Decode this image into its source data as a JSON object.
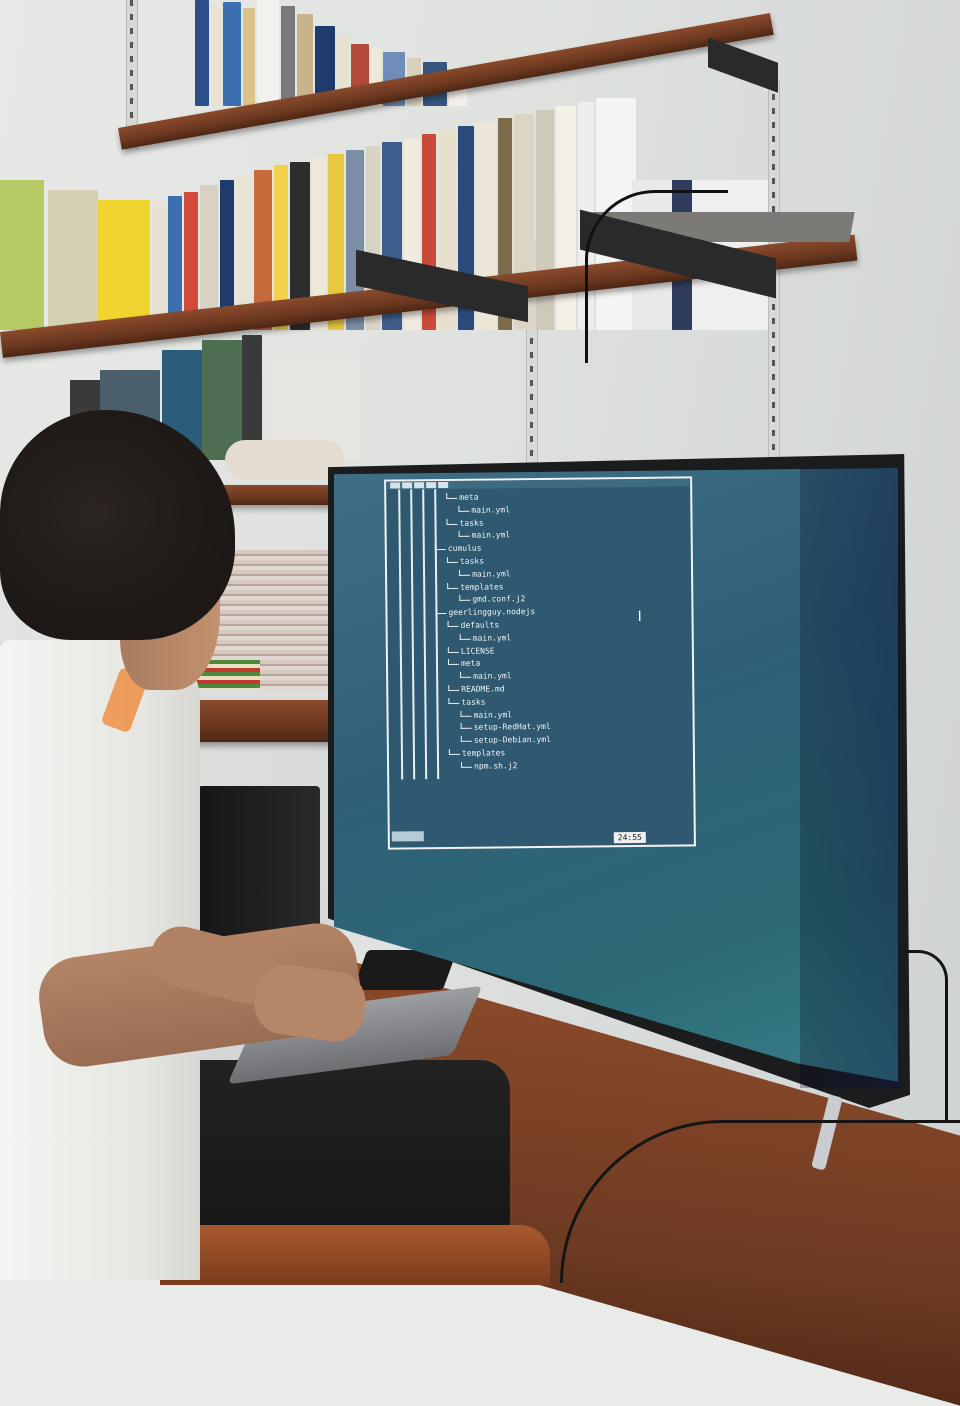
{
  "terminal": {
    "tree": [
      {
        "depth": 4,
        "text": "meta"
      },
      {
        "depth": 5,
        "text": "main.yml"
      },
      {
        "depth": 4,
        "text": "tasks"
      },
      {
        "depth": 5,
        "text": "main.yml"
      },
      {
        "depth": 3,
        "text": "cumulus"
      },
      {
        "depth": 4,
        "text": "tasks"
      },
      {
        "depth": 5,
        "text": "main.yml"
      },
      {
        "depth": 4,
        "text": "templates"
      },
      {
        "depth": 5,
        "text": "gmd.conf.j2"
      },
      {
        "depth": 3,
        "text": "geerlingguy.nodejs"
      },
      {
        "depth": 4,
        "text": "defaults"
      },
      {
        "depth": 5,
        "text": "main.yml"
      },
      {
        "depth": 4,
        "text": "LICENSE"
      },
      {
        "depth": 4,
        "text": "meta"
      },
      {
        "depth": 5,
        "text": "main.yml"
      },
      {
        "depth": 4,
        "text": "README.md"
      },
      {
        "depth": 4,
        "text": "tasks"
      },
      {
        "depth": 5,
        "text": "main.yml"
      },
      {
        "depth": 5,
        "text": "setup-RedHat.yml"
      },
      {
        "depth": 5,
        "text": "setup-Debian.yml"
      },
      {
        "depth": 4,
        "text": "templates"
      },
      {
        "depth": 5,
        "text": "npm.sh.j2"
      }
    ],
    "clock": "24:55"
  },
  "colors": {
    "screen": "#2f6078",
    "terminal_bg": "#2f5970",
    "shelf_wood": "#7a4024",
    "shirt": "#f2f2f0"
  },
  "icons": [
    "text-cursor-icon"
  ]
}
